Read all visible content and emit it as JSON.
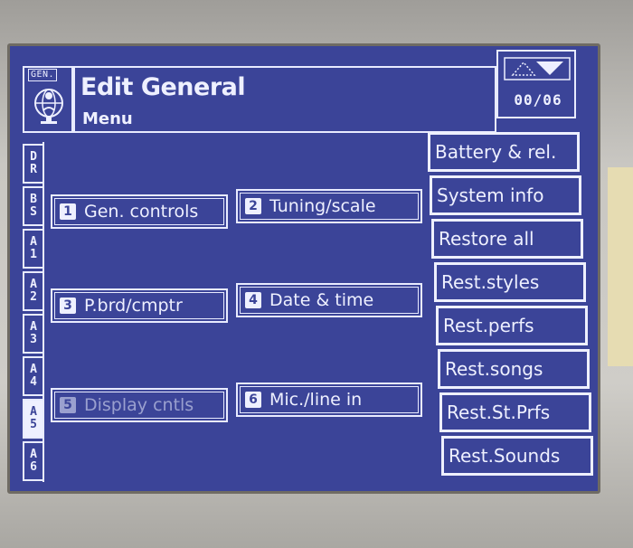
{
  "header": {
    "logo_label": "GEN.",
    "title": "Edit General",
    "subtitle": "Menu",
    "page_counter": "00/06"
  },
  "side_tabs": [
    {
      "label": "D\nR",
      "active": false
    },
    {
      "label": "B\nS",
      "active": false
    },
    {
      "label": "A\n1",
      "active": false
    },
    {
      "label": "A\n2",
      "active": false
    },
    {
      "label": "A\n3",
      "active": false
    },
    {
      "label": "A\n4",
      "active": false
    },
    {
      "label": "A\n5",
      "active": true
    },
    {
      "label": "A\n6",
      "active": false
    }
  ],
  "menu": {
    "items": [
      {
        "num": "1",
        "label": "Gen. controls",
        "enabled": true
      },
      {
        "num": "2",
        "label": "Tuning/scale",
        "enabled": true
      },
      {
        "num": "3",
        "label": "P.brd/cmptr",
        "enabled": true
      },
      {
        "num": "4",
        "label": "Date & time",
        "enabled": true
      },
      {
        "num": "5",
        "label": "Display cntls",
        "enabled": false
      },
      {
        "num": "6",
        "label": "Mic./line in",
        "enabled": true
      }
    ]
  },
  "right_menu": {
    "items": [
      "Battery & rel.",
      "System info",
      "Restore all",
      "Rest.styles",
      "Rest.perfs",
      "Rest.songs",
      "Rest.St.Prfs",
      "Rest.Sounds"
    ]
  },
  "colors": {
    "screen_bg": "#3b4498",
    "foreground": "#eef0ff",
    "disabled": "#9aa0cf"
  }
}
